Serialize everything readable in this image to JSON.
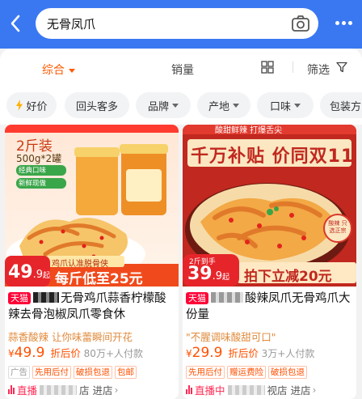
{
  "search": {
    "query": "无骨凤爪"
  },
  "sort_bar": {
    "comprehensive": "综合",
    "sales": "销量",
    "filter": "筛选"
  },
  "chips": [
    "好价",
    "回头客多",
    "品牌",
    "产地",
    "口味",
    "包装方"
  ],
  "colors": {
    "brand_blue": "#3a78f2",
    "accent_orange": "#ff5a00",
    "tmall_red": "#ff0036"
  },
  "products": [
    {
      "image": {
        "badge_top": "2斤装",
        "badge_sub": "500g*2罐",
        "check1": "经典口味",
        "check2": "新鲜现做",
        "banner": "鸡爪认准脱骨侠",
        "price_num": "49",
        "price_dec": ".9",
        "price_suffix": "起",
        "promo": "每斤低至25元"
      },
      "tmall": "天猫",
      "title": "无骨鸡爪蒜香柠檬酸辣去骨泡椒凤爪零食休",
      "subtitle": "蒜香酸辣 让你味蕾瞬间开花",
      "yen": "¥",
      "price": "49.9",
      "price_label": "折后价",
      "sold": "80万+人付款",
      "tags": [
        "广告",
        "先用后付",
        "破损包退",
        "包邮"
      ],
      "live": "直播",
      "store": "店 进店"
    },
    {
      "image": {
        "header": "酸甜鲜辣 打爆舌尖",
        "slogan": "千万补贴 价同双11",
        "badge_top": "2斤到手",
        "price_num": "39",
        "price_dec": ".9",
        "price_suffix": "起",
        "promo": "拍下立减20元",
        "stamp": "酸辣 只选正宗"
      },
      "tmall": "天猫",
      "title": "酸辣凤爪无骨鸡爪大份量",
      "subtitle": "\"不腥调味酸甜可口\"",
      "yen": "¥",
      "price": "29.9",
      "price_label": "折后价",
      "sold": "3万+人付款",
      "tags": [
        "先用后付",
        "赠运费险",
        "破损包退"
      ],
      "live": "直播中",
      "store": "视店 进店"
    }
  ]
}
